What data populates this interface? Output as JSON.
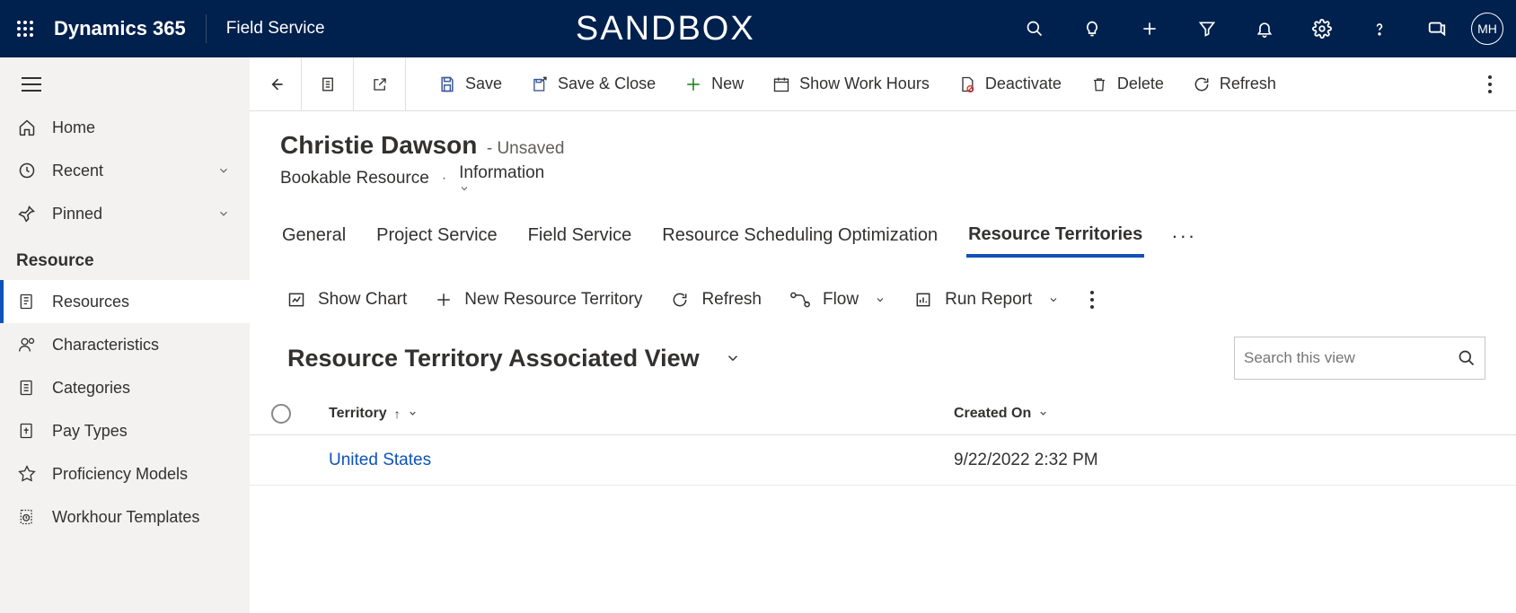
{
  "topbar": {
    "brand": "Dynamics 365",
    "app": "Field Service",
    "environment": "SANDBOX",
    "avatar_initials": "MH"
  },
  "sidebar": {
    "nav": {
      "home": "Home",
      "recent": "Recent",
      "pinned": "Pinned"
    },
    "group_label": "Resource",
    "items": [
      {
        "label": "Resources"
      },
      {
        "label": "Characteristics"
      },
      {
        "label": "Categories"
      },
      {
        "label": "Pay Types"
      },
      {
        "label": "Proficiency Models"
      },
      {
        "label": "Workhour Templates"
      }
    ]
  },
  "commandbar": {
    "save": "Save",
    "save_close": "Save & Close",
    "new": "New",
    "show_work_hours": "Show Work Hours",
    "deactivate": "Deactivate",
    "delete": "Delete",
    "refresh": "Refresh"
  },
  "record": {
    "title": "Christie Dawson",
    "status": "- Unsaved",
    "entity_type": "Bookable Resource",
    "form": "Information"
  },
  "tabs": [
    "General",
    "Project Service",
    "Field Service",
    "Resource Scheduling Optimization",
    "Resource Territories"
  ],
  "active_tab_index": 4,
  "sub_commandbar": {
    "show_chart": "Show Chart",
    "new_rt": "New Resource Territory",
    "refresh": "Refresh",
    "flow": "Flow",
    "run_report": "Run Report"
  },
  "view": {
    "title": "Resource Territory Associated View",
    "search_placeholder": "Search this view"
  },
  "grid": {
    "columns": {
      "territory": "Territory",
      "created_on": "Created On"
    },
    "rows": [
      {
        "territory": "United States",
        "created_on": "9/22/2022 2:32 PM"
      }
    ]
  }
}
